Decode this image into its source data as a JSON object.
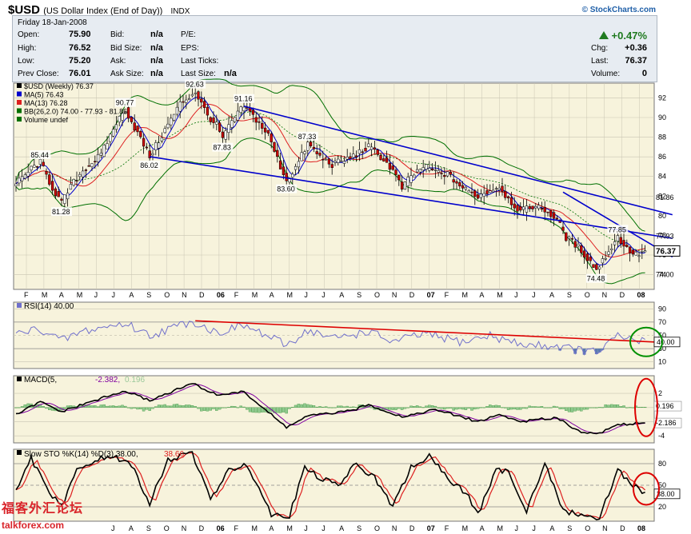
{
  "header": {
    "symbol": "$USD",
    "name": "(US Dollar Index (End of Day))",
    "exchange": "INDX",
    "copyright": "© StockCharts.com"
  },
  "quote": {
    "date": "Friday  18-Jan-2008",
    "open_label": "Open:",
    "open": "75.90",
    "high_label": "High:",
    "high": "76.52",
    "low_label": "Low:",
    "low": "75.20",
    "prev_label": "Prev Close:",
    "prev": "76.01",
    "bid_label": "Bid:",
    "bid": "n/a",
    "bidsize_label": "Bid Size:",
    "bidsize": "n/a",
    "ask_label": "Ask:",
    "ask": "n/a",
    "asksize_label": "Ask Size:",
    "asksize": "n/a",
    "pe_label": "P/E:",
    "eps_label": "EPS:",
    "lastticks_label": "Last Ticks:",
    "lastsize_label": "Last Size:",
    "lastsize": "n/a",
    "pct_change": "+0.47%",
    "chg_label": "Chg:",
    "chg": "+0.36",
    "last_label": "Last:",
    "last": "76.37",
    "volume_label": "Volume:",
    "volume": "0",
    "up_color": "#1f7a1f"
  },
  "colors": {
    "panel_bg": "#f7f3dc",
    "grid": "#c9c5b3",
    "up": "#ffffff",
    "down": "#cc0000",
    "ma5": "#0000cc",
    "ma13": "#dd2020",
    "bb": "#007000",
    "trend": "#0000cc",
    "rsi": "#7070cc",
    "macd": "#000000",
    "signal": "#8000a0",
    "hist": "#2a8a2a",
    "stok": "#000000",
    "stod": "#dd2020",
    "circle_red": "#dd0000",
    "circle_green": "#009000",
    "watermark": "#d9242a"
  },
  "chart_data": [
    {
      "type": "candlestick",
      "title": "$USD (Weekly) 76.37",
      "legend": [
        "MA(5) 76.43",
        "MA(13) 76.28",
        "BB(26,2.0) 74.00 - 77.93 - 81.86",
        "Volume undef"
      ],
      "ylim": [
        72.5,
        93.5
      ],
      "y_ticks": [
        92,
        90,
        88,
        86,
        84,
        82,
        80,
        78,
        76,
        74
      ],
      "x_labels": [
        "F",
        "M",
        "A",
        "M",
        "J",
        "J",
        "A",
        "S",
        "O",
        "N",
        "D",
        "06",
        "F",
        "M",
        "A",
        "M",
        "J",
        "J",
        "A",
        "S",
        "O",
        "N",
        "D",
        "07",
        "F",
        "M",
        "A",
        "M",
        "J",
        "J",
        "A",
        "S",
        "O",
        "N",
        "D",
        "08"
      ],
      "price_anchors": [
        [
          0,
          83.2
        ],
        [
          5,
          84.8
        ],
        [
          8,
          85.44
        ],
        [
          12,
          82.8
        ],
        [
          15,
          81.28
        ],
        [
          18,
          83.0
        ],
        [
          22,
          84.6
        ],
        [
          28,
          86.2
        ],
        [
          33,
          89.5
        ],
        [
          36,
          90.77
        ],
        [
          40,
          88.4
        ],
        [
          44,
          86.02
        ],
        [
          48,
          88.2
        ],
        [
          54,
          91.4
        ],
        [
          59,
          92.63
        ],
        [
          63,
          90.2
        ],
        [
          66,
          89.2
        ],
        [
          68,
          87.83
        ],
        [
          71,
          89.6
        ],
        [
          75,
          91.16
        ],
        [
          79,
          89.8
        ],
        [
          83,
          88.2
        ],
        [
          87,
          85.0
        ],
        [
          89,
          83.6
        ],
        [
          92,
          84.9
        ],
        [
          96,
          87.33
        ],
        [
          100,
          86.0
        ],
        [
          104,
          85.2
        ],
        [
          110,
          85.9
        ],
        [
          116,
          87.0
        ],
        [
          120,
          86.0
        ],
        [
          124,
          84.6
        ],
        [
          127,
          82.8
        ],
        [
          130,
          84.0
        ],
        [
          134,
          85.0
        ],
        [
          138,
          84.5
        ],
        [
          142,
          84.2
        ],
        [
          147,
          82.8
        ],
        [
          152,
          82.0
        ],
        [
          156,
          82.6
        ],
        [
          159,
          83.0
        ],
        [
          162,
          81.7
        ],
        [
          166,
          80.4
        ],
        [
          170,
          81.0
        ],
        [
          174,
          80.6
        ],
        [
          178,
          79.6
        ],
        [
          181,
          77.8
        ],
        [
          185,
          76.8
        ],
        [
          189,
          75.3
        ],
        [
          191,
          74.48
        ],
        [
          194,
          75.9
        ],
        [
          198,
          77.85
        ],
        [
          201,
          76.6
        ],
        [
          204,
          76.0
        ],
        [
          207,
          76.37
        ]
      ],
      "annotations": [
        {
          "label": "85.44",
          "i": 8,
          "v": 85.44,
          "pos": "above"
        },
        {
          "label": "81.28",
          "i": 15,
          "v": 81.28,
          "pos": "below"
        },
        {
          "label": "90.77",
          "i": 36,
          "v": 90.77,
          "pos": "above"
        },
        {
          "label": "86.02",
          "i": 44,
          "v": 86.02,
          "pos": "below"
        },
        {
          "label": "92.63",
          "i": 59,
          "v": 92.63,
          "pos": "above"
        },
        {
          "label": "87.83",
          "i": 68,
          "v": 87.83,
          "pos": "below"
        },
        {
          "label": "91.16",
          "i": 75,
          "v": 91.16,
          "pos": "above"
        },
        {
          "label": "83.60",
          "i": 89,
          "v": 83.6,
          "pos": "below"
        },
        {
          "label": "87.33",
          "i": 96,
          "v": 87.33,
          "pos": "above"
        },
        {
          "label": "77.85",
          "i": 198,
          "v": 77.85,
          "pos": "above"
        },
        {
          "label": "74.48",
          "i": 191,
          "v": 74.48,
          "pos": "below"
        }
      ],
      "right_labels": [
        {
          "label": "81.86",
          "v": 81.86,
          "boxed": false
        },
        {
          "label": "77.93",
          "v": 77.93,
          "boxed": false
        },
        {
          "label": "76.37",
          "v": 76.37,
          "boxed": true
        },
        {
          "label": "74.00",
          "v": 74.0,
          "boxed": false
        }
      ],
      "trendlines": [
        {
          "from": [
            75,
            91.16
          ],
          "to": [
            216,
            80.1
          ]
        },
        {
          "from": [
            44,
            86.02
          ],
          "to": [
            216,
            77.7
          ]
        },
        {
          "from": [
            180,
            82.4
          ],
          "to": [
            216,
            75.8
          ]
        }
      ]
    },
    {
      "type": "line",
      "title": "RSI(14) 40.00",
      "ylim": [
        0,
        100
      ],
      "y_ticks": [
        90,
        70,
        50,
        30,
        10
      ],
      "series_name": "RSI(14)",
      "anchors": [
        [
          0,
          52
        ],
        [
          8,
          60
        ],
        [
          15,
          42
        ],
        [
          22,
          56
        ],
        [
          30,
          63
        ],
        [
          36,
          68
        ],
        [
          44,
          50
        ],
        [
          52,
          62
        ],
        [
          58,
          72
        ],
        [
          66,
          54
        ],
        [
          75,
          65
        ],
        [
          89,
          35
        ],
        [
          96,
          58
        ],
        [
          104,
          45
        ],
        [
          116,
          56
        ],
        [
          124,
          40
        ],
        [
          134,
          52
        ],
        [
          147,
          40
        ],
        [
          156,
          50
        ],
        [
          166,
          36
        ],
        [
          178,
          34
        ],
        [
          185,
          28
        ],
        [
          191,
          24
        ],
        [
          198,
          48
        ],
        [
          207,
          40
        ]
      ],
      "last_label": "40.00",
      "trendline": {
        "from": [
          59,
          72
        ],
        "to": [
          210,
          40
        ]
      }
    },
    {
      "type": "line",
      "title": "MACD(5,34,5) -2.186, -2.382, 0.196",
      "ylim": [
        -5,
        4.5
      ],
      "y_ticks": [
        2,
        0,
        -2,
        -4
      ],
      "series": [
        {
          "name": "MACD",
          "anchors": [
            [
              0,
              -1.0
            ],
            [
              8,
              0.8
            ],
            [
              15,
              -0.6
            ],
            [
              28,
              1.3
            ],
            [
              36,
              2.3
            ],
            [
              44,
              1.0
            ],
            [
              58,
              3.4
            ],
            [
              66,
              1.8
            ],
            [
              75,
              2.2
            ],
            [
              89,
              -2.8
            ],
            [
              96,
              -1.2
            ],
            [
              110,
              -0.5
            ],
            [
              116,
              0.4
            ],
            [
              127,
              -1.3
            ],
            [
              138,
              -0.3
            ],
            [
              152,
              -2.0
            ],
            [
              159,
              -1.0
            ],
            [
              166,
              -2.0
            ],
            [
              178,
              -1.4
            ],
            [
              185,
              -3.3
            ],
            [
              191,
              -3.8
            ],
            [
              198,
              -2.4
            ],
            [
              207,
              -2.186
            ]
          ]
        },
        {
          "name": "Signal",
          "lag": 3
        }
      ],
      "hist_last": "0.196",
      "last_labels": [
        {
          "label": "0.196",
          "v": 0.196
        },
        {
          "label": "-2.186",
          "v": -2.186
        }
      ]
    },
    {
      "type": "line",
      "title": "Slow STO %K(14) %D(3) 38.00, 38.66",
      "ylim": [
        0,
        100
      ],
      "y_ticks": [
        80,
        50,
        20
      ],
      "series": [
        {
          "name": "%K",
          "anchors": [
            [
              0,
              40
            ],
            [
              5,
              88
            ],
            [
              10,
              45
            ],
            [
              15,
              20
            ],
            [
              20,
              70
            ],
            [
              26,
              85
            ],
            [
              32,
              90
            ],
            [
              38,
              78
            ],
            [
              44,
              25
            ],
            [
              50,
              85
            ],
            [
              58,
              95
            ],
            [
              64,
              30
            ],
            [
              70,
              70
            ],
            [
              76,
              80
            ],
            [
              84,
              10
            ],
            [
              90,
              8
            ],
            [
              95,
              75
            ],
            [
              100,
              60
            ],
            [
              106,
              50
            ],
            [
              112,
              80
            ],
            [
              118,
              60
            ],
            [
              124,
              20
            ],
            [
              130,
              75
            ],
            [
              136,
              90
            ],
            [
              142,
              60
            ],
            [
              148,
              40
            ],
            [
              152,
              10
            ],
            [
              158,
              70
            ],
            [
              162,
              70
            ],
            [
              168,
              15
            ],
            [
              174,
              80
            ],
            [
              180,
              15
            ],
            [
              186,
              8
            ],
            [
              192,
              5
            ],
            [
              198,
              72
            ],
            [
              203,
              50
            ],
            [
              207,
              38
            ]
          ]
        },
        {
          "name": "%D",
          "lag": 2
        }
      ],
      "last_label": "38.00"
    }
  ],
  "x_axis_top": [
    "F",
    "M",
    "A",
    "M",
    "J",
    "J",
    "A",
    "S",
    "O",
    "N",
    "D",
    "06",
    "F",
    "M",
    "A",
    "M",
    "J",
    "J",
    "A",
    "S",
    "O",
    "N",
    "D",
    "07",
    "F",
    "M",
    "A",
    "M",
    "J",
    "J",
    "A",
    "S",
    "O",
    "N",
    "D",
    "08"
  ],
  "x_axis_bottom": [
    "J",
    "A",
    "S",
    "O",
    "N",
    "D",
    "06",
    "F",
    "M",
    "A",
    "M",
    "J",
    "J",
    "A",
    "S",
    "O",
    "N",
    "D",
    "07",
    "F",
    "M",
    "A",
    "M",
    "J",
    "J",
    "A",
    "S",
    "O",
    "N",
    "D",
    "08"
  ],
  "watermark": {
    "cn": "福客外汇论坛",
    "en": "talkforex.com"
  }
}
